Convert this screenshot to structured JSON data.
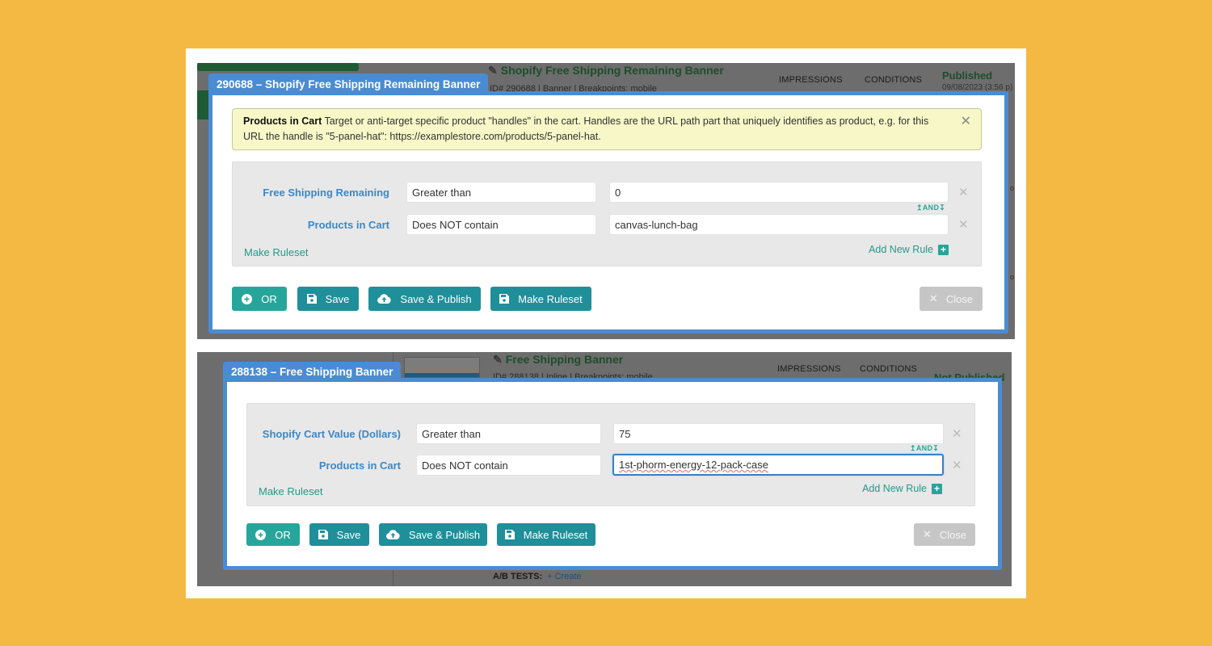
{
  "screens": [
    {
      "bg": {
        "title": "Shopify Free Shipping Remaining Banner",
        "subtitle": "ID# 290688 | Banner | Breakpoints: mobile",
        "col1": "IMPRESSIONS",
        "col2": "CONDITIONS",
        "status": "Published",
        "status_date": "09/08/2023 (3:56 p)"
      },
      "tab_title": "290688 – Shopify Free Shipping Remaining Banner",
      "alert": {
        "bold": "Products in Cart",
        "text": " Target or anti-target specific product \"handles\" in the cart. Handles are the URL path part that uniquely identifies as product, e.g. for this URL the handle is \"5-panel-hat\": https://examplestore.com/products/5-panel-hat."
      },
      "rules": [
        {
          "label": "Free Shipping Remaining",
          "operator": "Greater than",
          "value": "0"
        },
        {
          "label": "Products in Cart",
          "operator": "Does NOT contain",
          "value": "canvas-lunch-bag"
        }
      ],
      "and_label": "AND",
      "make_ruleset_link": "Make Ruleset",
      "add_new_rule": "Add New Rule",
      "buttons": {
        "or": "OR",
        "save": "Save",
        "save_publish": "Save & Publish",
        "make_ruleset": "Make Ruleset",
        "close": "Close"
      }
    },
    {
      "bg": {
        "title": "Free Shipping Banner",
        "subtitle": "ID# 288138 | Inline | Breakpoints: mobile",
        "col1": "IMPRESSIONS",
        "col2": "CONDITIONS",
        "status": "Not Published",
        "ab_label": "A/B TESTS:",
        "ab_create": "+ Create"
      },
      "tab_title": "288138 – Free Shipping Banner",
      "rules": [
        {
          "label": "Shopify Cart Value (Dollars)",
          "operator": "Greater than",
          "value": "75"
        },
        {
          "label": "Products in Cart",
          "operator": "Does NOT contain",
          "value": "1st-phorm-energy-12-pack-case"
        }
      ],
      "and_label": "AND",
      "make_ruleset_link": "Make Ruleset",
      "add_new_rule": "Add New Rule",
      "buttons": {
        "or": "OR",
        "save": "Save",
        "save_publish": "Save & Publish",
        "make_ruleset": "Make Ruleset",
        "close": "Close"
      }
    }
  ]
}
